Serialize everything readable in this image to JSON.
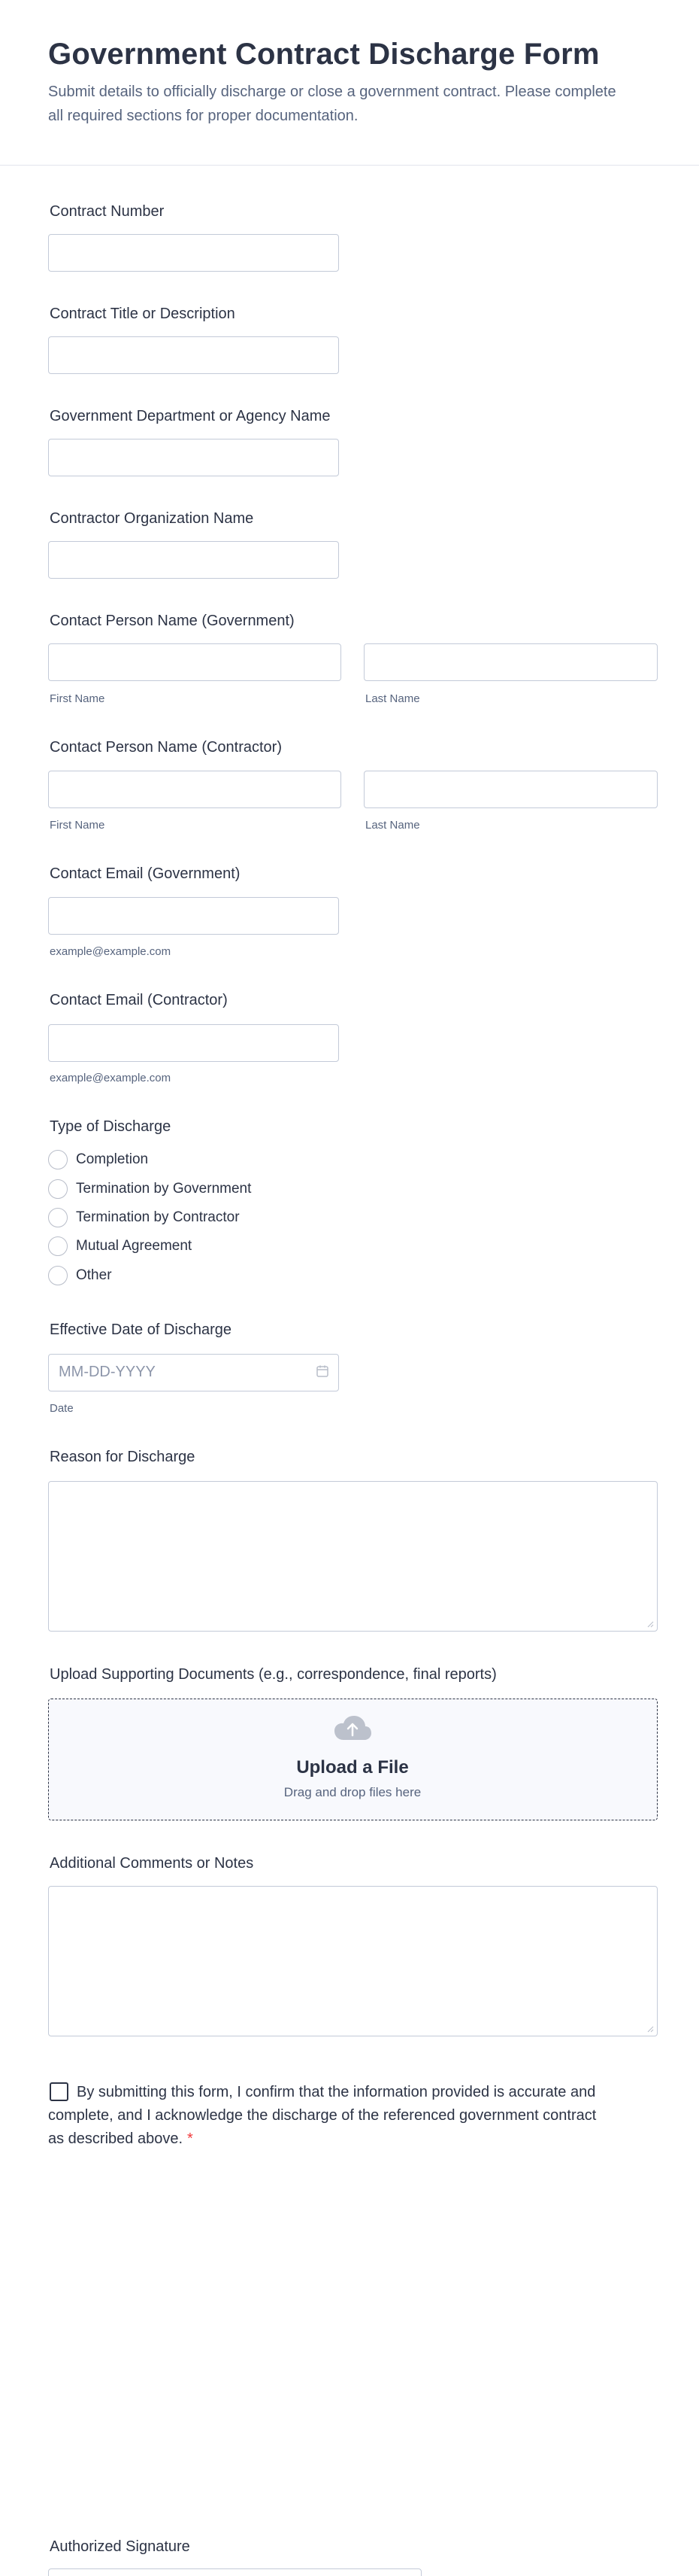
{
  "header": {
    "title": "Government Contract Discharge Form",
    "subtitle": "Submit details to officially discharge or close a government contract. Please complete all required sections for proper documentation."
  },
  "fields": {
    "contract_number": {
      "label": "Contract Number",
      "value": ""
    },
    "contract_title": {
      "label": "Contract Title or Description",
      "value": ""
    },
    "department": {
      "label": "Government Department or Agency Name",
      "value": ""
    },
    "contractor_org": {
      "label": "Contractor Organization Name",
      "value": ""
    },
    "contact_gov": {
      "label": "Contact Person Name (Government)",
      "first_sublabel": "First Name",
      "last_sublabel": "Last Name",
      "first_value": "",
      "last_value": ""
    },
    "contact_contractor": {
      "label": "Contact Person Name (Contractor)",
      "first_sublabel": "First Name",
      "last_sublabel": "Last Name",
      "first_value": "",
      "last_value": ""
    },
    "email_gov": {
      "label": "Contact Email (Government)",
      "sublabel": "example@example.com",
      "value": ""
    },
    "email_contractor": {
      "label": "Contact Email (Contractor)",
      "sublabel": "example@example.com",
      "value": ""
    },
    "discharge_type": {
      "label": "Type of Discharge",
      "options": [
        "Completion",
        "Termination by Government",
        "Termination by Contractor",
        "Mutual Agreement",
        "Other"
      ]
    },
    "effective_date": {
      "label": "Effective Date of Discharge",
      "placeholder": "MM-DD-YYYY",
      "sublabel": "Date",
      "icon": "calendar-icon"
    },
    "reason": {
      "label": "Reason for Discharge",
      "value": ""
    },
    "upload": {
      "label": "Upload Supporting Documents (e.g., correspondence, final reports)",
      "title": "Upload a File",
      "subtitle": "Drag and drop files here",
      "icon": "cloud-upload-icon"
    },
    "comments": {
      "label": "Additional Comments or Notes",
      "value": ""
    },
    "consent": {
      "text": "By submitting this form, I confirm that the information provided is accurate and complete, and I acknowledge the discharge of the referenced government contract as described above.",
      "required_mark": "*",
      "checked": false
    },
    "signature": {
      "label": "Authorized Signature"
    }
  },
  "colors": {
    "text": "#2c3345",
    "muted": "#57647e",
    "border": "#c3cad8",
    "required": "#f23a3c",
    "upload_bg": "#f8f9fd"
  }
}
